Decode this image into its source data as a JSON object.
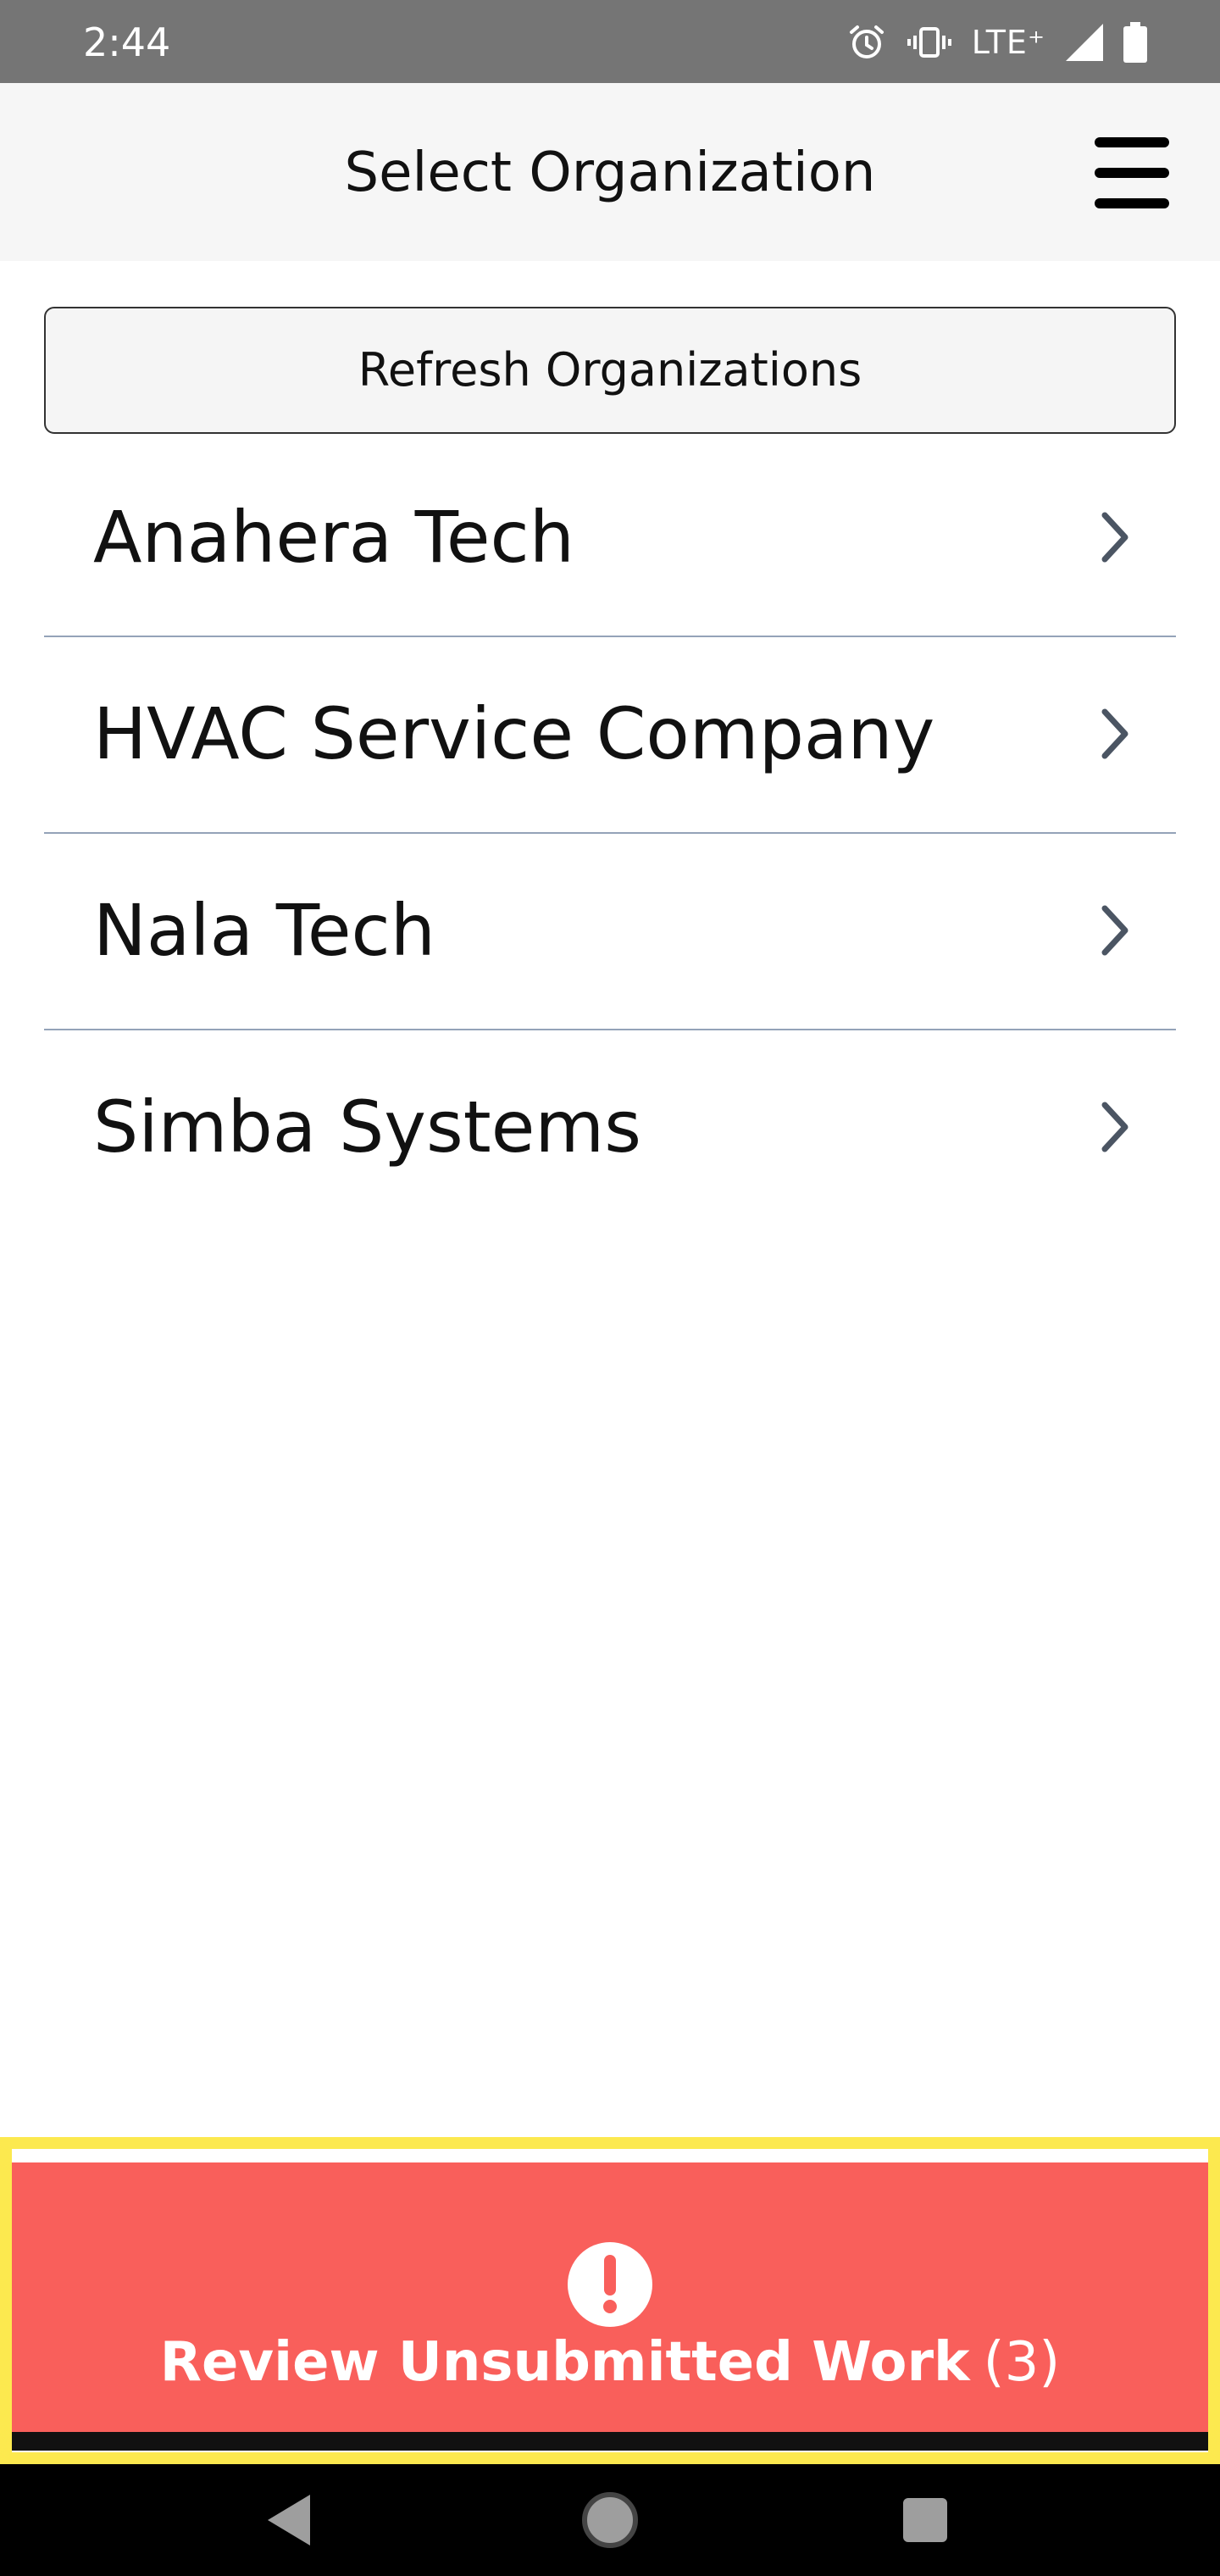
{
  "status_bar": {
    "time": "2:44",
    "network": "LTE⁺",
    "icons": [
      "alarm-icon",
      "vibrate-icon",
      "signal-icon",
      "battery-icon"
    ]
  },
  "header": {
    "title": "Select Organization",
    "menu_icon": "hamburger-menu-icon"
  },
  "refresh_button": {
    "label": "Refresh Organizations"
  },
  "organizations": [
    {
      "name": "Anahera Tech"
    },
    {
      "name": "HVAC Service Company"
    },
    {
      "name": "Nala Tech"
    },
    {
      "name": "Simba Systems"
    }
  ],
  "review": {
    "label": "Review Unsubmitted Work",
    "count": "(3)",
    "icon": "exclamation-circle-icon"
  },
  "nav_bar": {
    "icons": [
      "back-icon",
      "home-icon",
      "recents-icon"
    ]
  },
  "colors": {
    "status_bar": "#757575",
    "header_bg": "#f6f6f6",
    "review_bg": "#f95f5b",
    "review_highlight": "#fce94f",
    "divider": "#94a3b8",
    "chevron": "#4b5563"
  }
}
